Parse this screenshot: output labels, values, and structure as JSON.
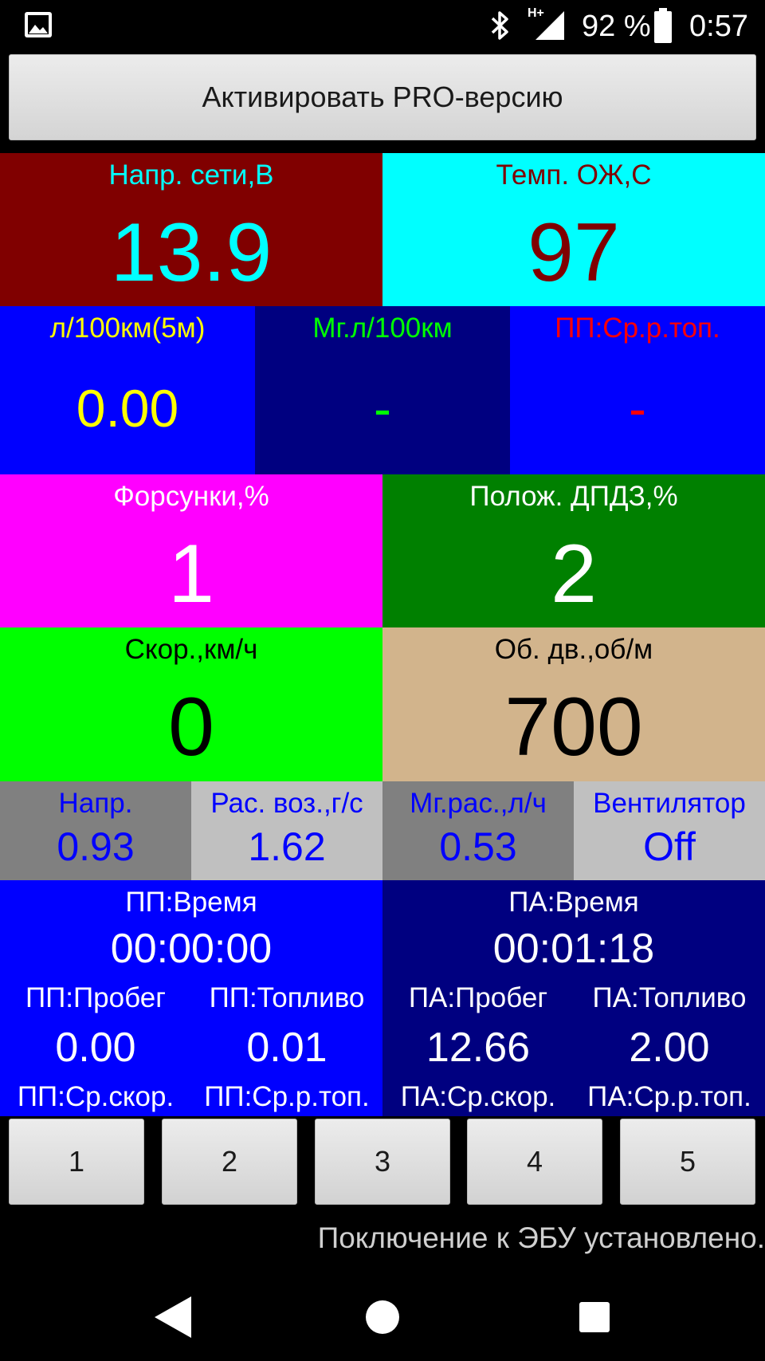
{
  "status_bar": {
    "battery_percent": "92 %",
    "time": "0:57",
    "network_label": "H+",
    "icons": [
      "image-notification-icon",
      "bluetooth-icon",
      "signal-icon",
      "battery-icon"
    ]
  },
  "promo_button": "Активировать PRO-версию",
  "gauges": {
    "voltage": {
      "label": "Напр. сети,В",
      "value": "13.9"
    },
    "coolant_temp": {
      "label": "Темп. ОЖ,С",
      "value": "97"
    },
    "fuel_5m": {
      "label": "л/100км(5м)",
      "value": "0.00"
    },
    "instant_fuel": {
      "label": "Мг.л/100км",
      "value": "-"
    },
    "trip_avg_fuel": {
      "label": "ПП:Ср.р.топ.",
      "value": "-"
    },
    "injectors": {
      "label": "Форсунки,%",
      "value": "1"
    },
    "throttle": {
      "label": "Полож. ДПДЗ,%",
      "value": "2"
    },
    "speed": {
      "label": "Скор.,км/ч",
      "value": "0"
    },
    "rpm": {
      "label": "Об. дв.,об/м",
      "value": "700"
    },
    "small": [
      {
        "label": "Напр.",
        "value": "0.93"
      },
      {
        "label": "Рас. воз.,г/с",
        "value": "1.62"
      },
      {
        "label": "Мг.рас.,л/ч",
        "value": "0.53"
      },
      {
        "label": "Вентилятор",
        "value": "Off"
      }
    ]
  },
  "trip": {
    "current": {
      "time_label": "ПП:Время",
      "time": "00:00:00",
      "distance_label": "ПП:Пробег",
      "distance": "0.00",
      "fuel_label": "ПП:Топливо",
      "fuel": "0.01",
      "avg_speed_label": "ПП:Ср.скор.",
      "avg_fuel_label": "ПП:Ср.р.топ."
    },
    "total": {
      "time_label": "ПА:Время",
      "time": "00:01:18",
      "distance_label": "ПА:Пробег",
      "distance": "12.66",
      "fuel_label": "ПА:Топливо",
      "fuel": "2.00",
      "avg_speed_label": "ПА:Ср.скор.",
      "avg_fuel_label": "ПА:Ср.р.топ."
    }
  },
  "tabs": [
    "1",
    "2",
    "3",
    "4",
    "5"
  ],
  "connection_status": "Поключение к ЭБУ установлено.",
  "nav": {
    "back": "back-icon",
    "home": "home-icon",
    "recents": "recents-icon"
  },
  "colors": {
    "maroon": "#800000",
    "cyan": "#00ffff",
    "blue": "#0000ff",
    "navy": "#000080",
    "magenta": "#ff00ff",
    "green": "#008000",
    "lime": "#00ff00",
    "tan": "#d2b48c",
    "gray": "#808080",
    "silver": "#c0c0c0",
    "yellow": "#ffff00",
    "red": "#ff0000"
  }
}
